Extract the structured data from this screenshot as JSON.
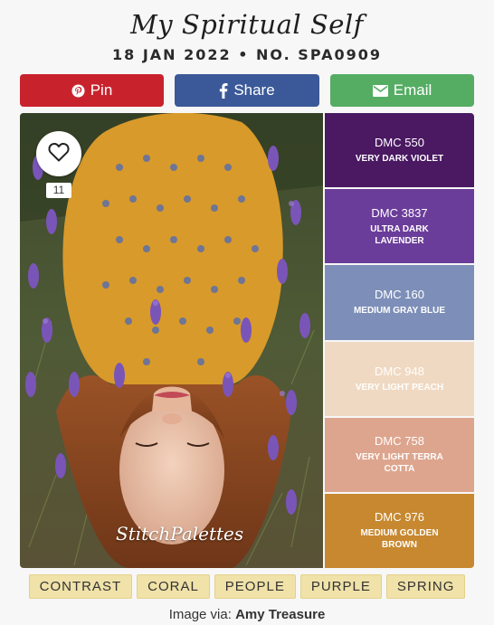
{
  "header": {
    "title": "My Spiritual Self",
    "subtitle": "18 JAN 2022 • NO. SPA0909"
  },
  "share": {
    "pin_label": "Pin",
    "share_label": "Share",
    "email_label": "Email",
    "pin_color": "#c8232c",
    "share_color": "#3b5998",
    "email_color": "#55ad63"
  },
  "photo": {
    "like_count": "11",
    "watermark": "StitchPalettes"
  },
  "swatches": [
    {
      "code": "DMC 550",
      "name": "VERY DARK VIOLET",
      "color": "#4a1962",
      "text_color": "#ffffff"
    },
    {
      "code": "DMC 3837",
      "name": "ULTRA DARK LAVENDER",
      "color": "#6b3d9a",
      "text_color": "#ffffff"
    },
    {
      "code": "DMC 160",
      "name": "MEDIUM GRAY BLUE",
      "color": "#7d8fb8",
      "text_color": "#ffffff"
    },
    {
      "code": "DMC 948",
      "name": "VERY LIGHT PEACH",
      "color": "#f0d9c2",
      "text_color": "#ffffff"
    },
    {
      "code": "DMC 758",
      "name": "VERY LIGHT TERRA COTTA",
      "color": "#dea58e",
      "text_color": "#ffffff"
    },
    {
      "code": "DMC 976",
      "name": "MEDIUM GOLDEN BROWN",
      "color": "#c7882f",
      "text_color": "#ffffff"
    }
  ],
  "tags": [
    "CONTRAST",
    "CORAL",
    "PEOPLE",
    "PURPLE",
    "SPRING"
  ],
  "credit": {
    "prefix": "Image via:",
    "author": "Amy Treasure"
  }
}
